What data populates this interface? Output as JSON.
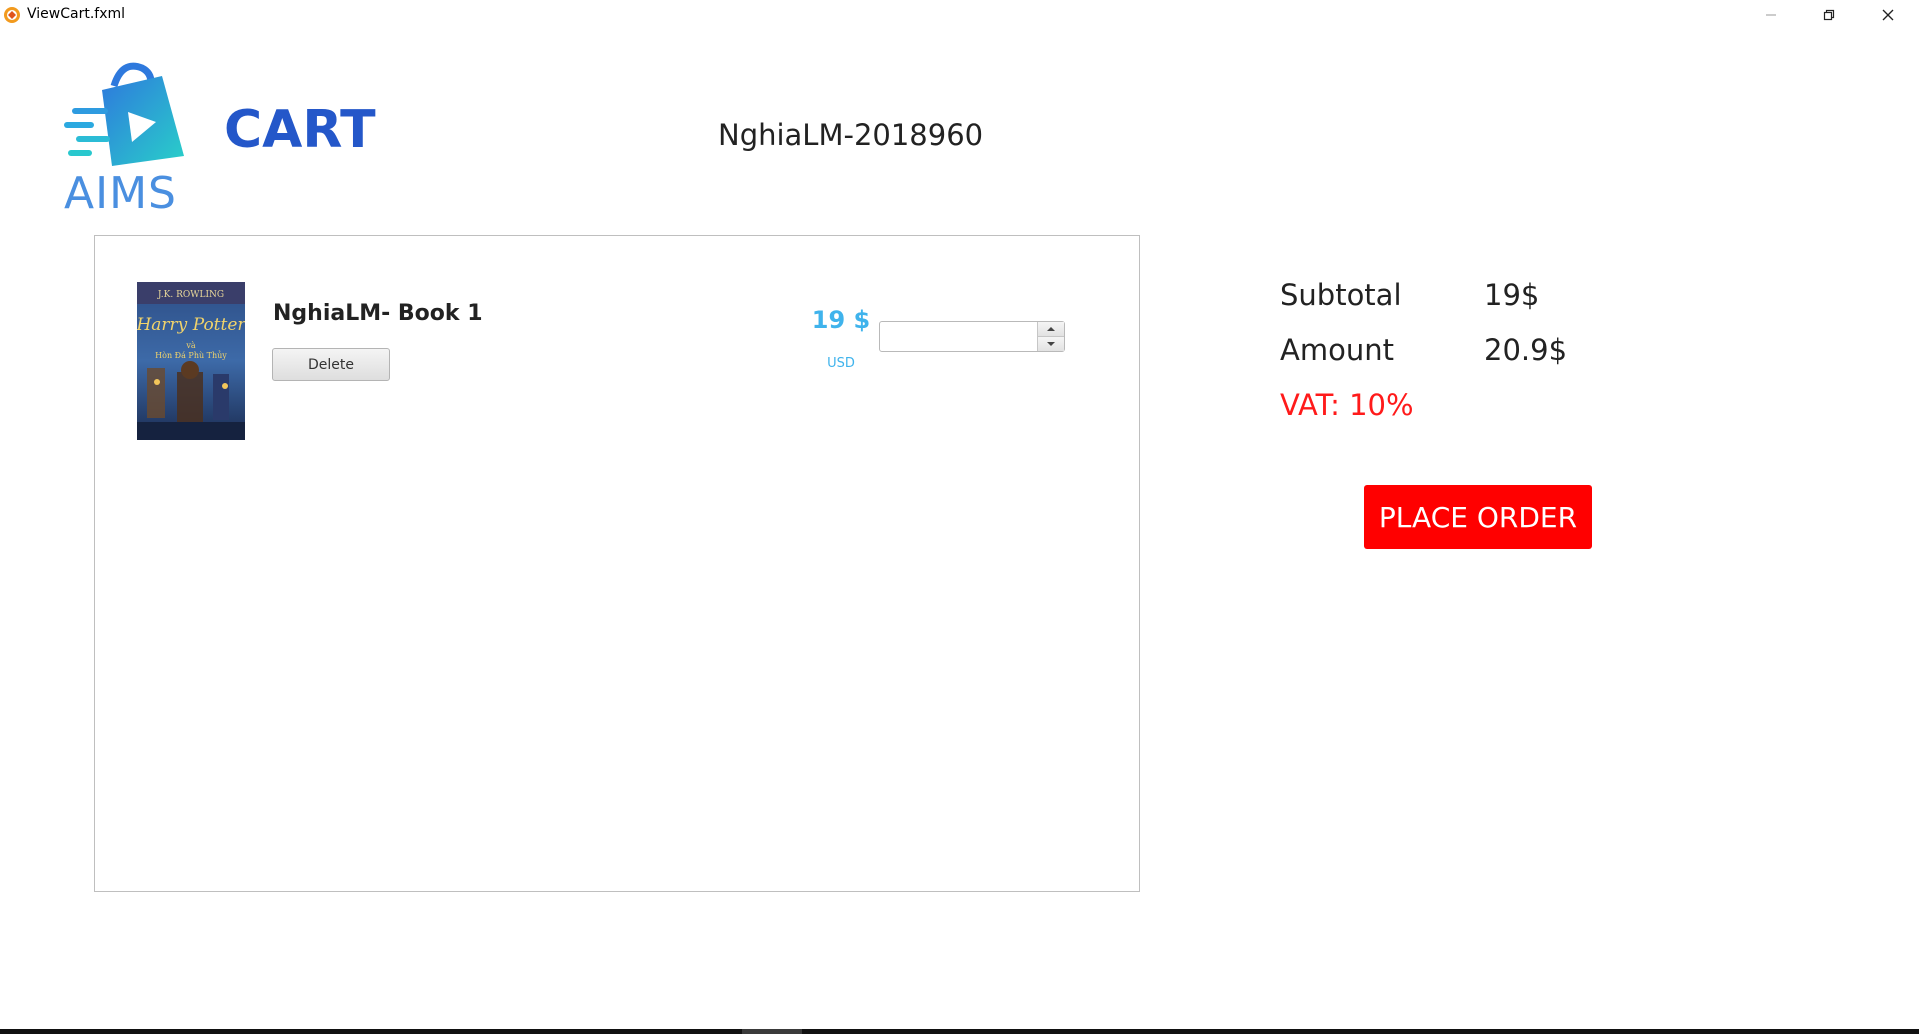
{
  "window": {
    "title": "ViewCart.fxml"
  },
  "header": {
    "logo_text": "AIMS",
    "page_title": "CART",
    "user_name": "NghiaLM-2018960"
  },
  "cart": {
    "items": [
      {
        "title": "NghiaLM- Book 1",
        "delete_label": "Delete",
        "price": "19 $",
        "currency": "USD",
        "quantity": "",
        "cover_text": "Harry Potter"
      }
    ]
  },
  "summary": {
    "subtotal_label": "Subtotal",
    "subtotal_value": "19$",
    "amount_label": "Amount",
    "amount_value": "20.9$",
    "vat": "VAT: 10%",
    "place_order_label": "PLACE ORDER"
  },
  "colors": {
    "title_blue": "#2457c9",
    "price_blue": "#3fb3ec",
    "vat_red": "#ff1a1a",
    "order_button": "#ff0000"
  }
}
